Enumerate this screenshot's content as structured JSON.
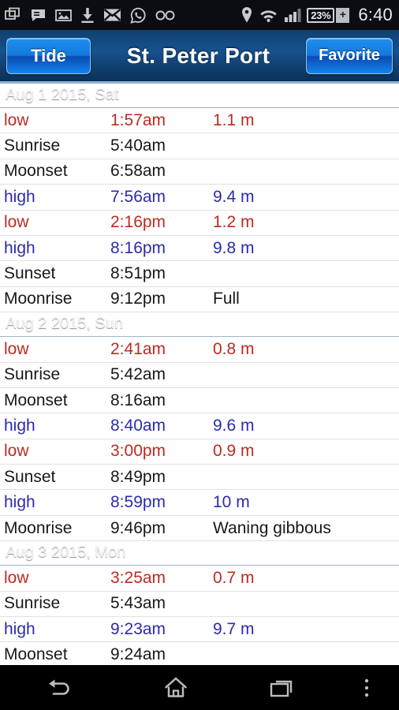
{
  "statusbar": {
    "icons": [
      {
        "name": "screenshot-icon"
      },
      {
        "name": "sms-message-icon"
      },
      {
        "name": "image-icon"
      },
      {
        "name": "download-icon"
      },
      {
        "name": "email-icon"
      },
      {
        "name": "whatsapp-icon"
      },
      {
        "name": "voicemail-icon"
      },
      {
        "name": "location-icon"
      },
      {
        "name": "wifi-icon"
      },
      {
        "name": "cellular-signal-icon"
      }
    ],
    "battery_percent": "23%",
    "battery_charging_glyph": "+",
    "clock": "6:40"
  },
  "titlebar": {
    "left_button": "Tide",
    "title": "St. Peter Port",
    "right_button": "Favorite"
  },
  "colors": {
    "low_tide": "#bc2b22",
    "high_tide": "#2b2bae",
    "neutral": "#16181a",
    "header_blue": "#315f8f",
    "accent_button": "#1378dd"
  },
  "days": [
    {
      "header": "Aug 1 2015, Sat",
      "rows": [
        {
          "type": "low",
          "time": "1:57am",
          "value": "1.1 m",
          "kind": "red"
        },
        {
          "type": "Sunrise",
          "time": "5:40am",
          "value": "",
          "kind": "neutral"
        },
        {
          "type": "Moonset",
          "time": "6:58am",
          "value": "",
          "kind": "neutral"
        },
        {
          "type": "high",
          "time": "7:56am",
          "value": "9.4 m",
          "kind": "blue"
        },
        {
          "type": "low",
          "time": "2:16pm",
          "value": "1.2 m",
          "kind": "red"
        },
        {
          "type": "high",
          "time": "8:16pm",
          "value": "9.8 m",
          "kind": "blue"
        },
        {
          "type": "Sunset",
          "time": "8:51pm",
          "value": "",
          "kind": "neutral"
        },
        {
          "type": "Moonrise",
          "time": "9:12pm",
          "value": "Full",
          "kind": "neutral"
        }
      ]
    },
    {
      "header": "Aug 2 2015, Sun",
      "rows": [
        {
          "type": "low",
          "time": "2:41am",
          "value": "0.8 m",
          "kind": "red"
        },
        {
          "type": "Sunrise",
          "time": "5:42am",
          "value": "",
          "kind": "neutral"
        },
        {
          "type": "Moonset",
          "time": "8:16am",
          "value": "",
          "kind": "neutral"
        },
        {
          "type": "high",
          "time": "8:40am",
          "value": "9.6 m",
          "kind": "blue"
        },
        {
          "type": "low",
          "time": "3:00pm",
          "value": "0.9 m",
          "kind": "red"
        },
        {
          "type": "Sunset",
          "time": "8:49pm",
          "value": "",
          "kind": "neutral"
        },
        {
          "type": "high",
          "time": "8:59pm",
          "value": "10 m",
          "kind": "blue"
        },
        {
          "type": "Moonrise",
          "time": "9:46pm",
          "value": "Waning gibbous",
          "kind": "neutral"
        }
      ]
    },
    {
      "header": "Aug 3 2015, Mon",
      "rows": [
        {
          "type": "low",
          "time": "3:25am",
          "value": "0.7 m",
          "kind": "red"
        },
        {
          "type": "Sunrise",
          "time": "5:43am",
          "value": "",
          "kind": "neutral"
        },
        {
          "type": "high",
          "time": "9:23am",
          "value": "9.7 m",
          "kind": "blue"
        },
        {
          "type": "Moonset",
          "time": "9:24am",
          "value": "",
          "kind": "neutral"
        }
      ]
    }
  ],
  "navbar": {
    "back_label": "Back",
    "home_label": "Home",
    "recents_label": "Recent apps",
    "menu_label": "Menu"
  }
}
